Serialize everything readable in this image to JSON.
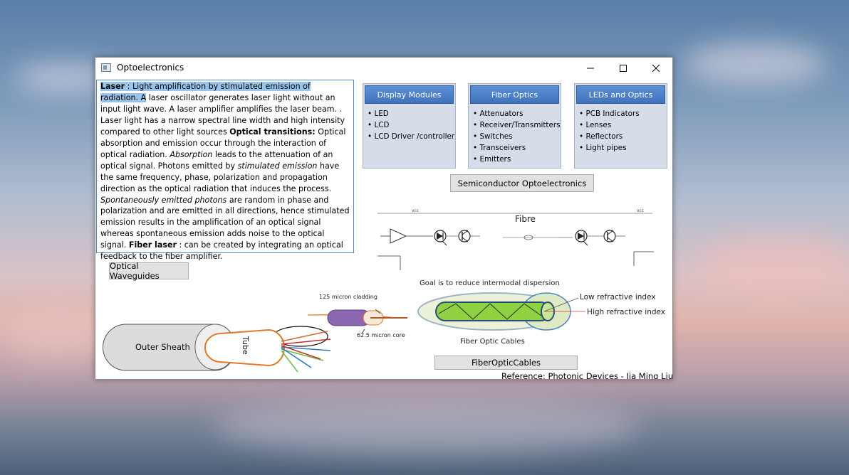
{
  "window": {
    "title": "Optoelectronics"
  },
  "description": {
    "p1": "Laser",
    "p2": " : Light amplification by stimulated emission of radiation. A",
    "p3": " laser oscillator generates laser light without an input light wave.  A laser amplifier amplifies the laser beam. . Laser light has a narrow spectral line width and high intensity compared to other light sources  ",
    "p4": "Optical transitions:",
    "p5": "   Optical absorption and emission occur through the interaction of optical radiation.    ",
    "p6": "Absorption",
    "p7": " leads to the attenuation of an optical signal. Photons emitted by ",
    "p8": "stimulated emission",
    "p9": "  have the same frequency, phase, polarization and propagation direction as the optical radiation that induces the process.  ",
    "p10": "Spontaneously emitted photons",
    "p11": "  are random in phase and polarization and are emitted in all directions, hence stimulated emission results in the amplification of an optical signal whereas spontaneous emission adds noise to the optical signal.   ",
    "p12": "Fiber laser",
    "p13": " : can be created by integrating an optical feedback to the fiber amplifier."
  },
  "panels": [
    {
      "title": "Display Modules",
      "items": [
        "LED",
        "LCD",
        "LCD Driver /controller"
      ]
    },
    {
      "title": "Fiber Optics",
      "items": [
        "Attenuators",
        "Receiver/Transmitters",
        "Switches",
        "Transceivers",
        "Emitters"
      ]
    },
    {
      "title": "LEDs and Optics",
      "items": [
        "PCB Indicators",
        "Lenses",
        "Reflectors",
        "Light pipes"
      ]
    }
  ],
  "buttons": {
    "semiconductor": "Semiconductor Optoelectronics",
    "waveguides": "Optical Waveguides",
    "fiber_cables": "FiberOpticCables"
  },
  "circuit": {
    "fibre": "Fibre",
    "vcc_left": "vcc",
    "vcc_right": "vcc"
  },
  "cable": {
    "goal": "Goal is to reduce intermodal dispersion",
    "low_index": "Low refractive index",
    "high_index": "High refractive index",
    "cladding": "125 micron cladding",
    "core": "62.5 micron core",
    "caption": "Fiber Optic Cables",
    "outer_sheath": "Outer Sheath",
    "tube": "Tube"
  },
  "reference": "Reference: Photonic Devices  - Jia Ming Liu"
}
